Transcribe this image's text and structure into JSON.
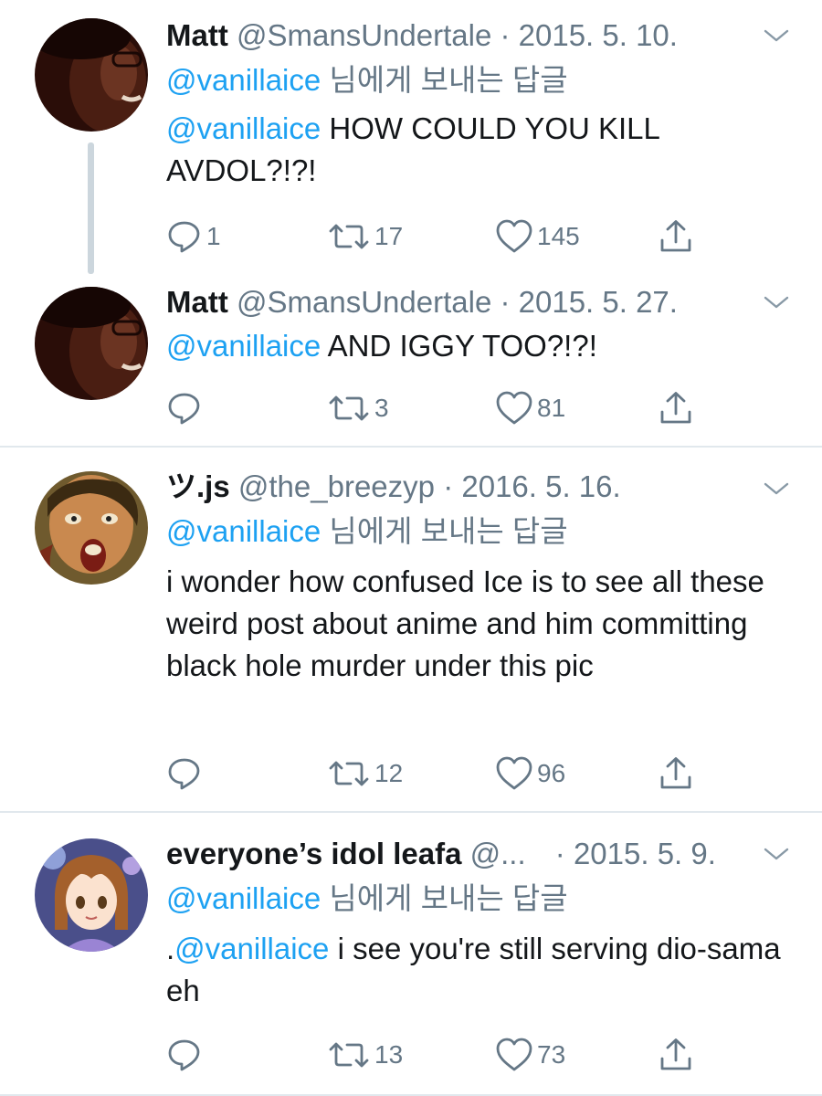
{
  "tweets": [
    {
      "name": "Matt",
      "handle": "@SmansUndertale",
      "dot": "·",
      "date": "2015. 5. 10.",
      "replying_mention": "@vanillaice",
      "replying_rest": " 님에게 보내는 답글",
      "body_mention": "@vanillaice",
      "body_text": " HOW COULD YOU KILL AVDOL?!?!",
      "replies": "1",
      "retweets": "17",
      "likes": "145",
      "avatar_icon": "dark-portrait-avatar"
    },
    {
      "name": "Matt",
      "handle": "@SmansUndertale",
      "dot": "·",
      "date": "2015. 5. 27.",
      "body_mention": "@vanillaice",
      "body_text": " AND IGGY TOO?!?!",
      "replies": "",
      "retweets": "3",
      "likes": "81",
      "avatar_icon": "dark-portrait-avatar"
    },
    {
      "name": "ツ.js",
      "handle": "@the_breezyp",
      "dot": "·",
      "date": "2016. 5. 16.",
      "replying_mention": "@vanillaice",
      "replying_rest": " 님에게 보내는 답글",
      "body_text": "i wonder how confused Ice is to see all these weird post about anime and him committing black hole murder under this pic",
      "replies": "",
      "retweets": "12",
      "likes": "96",
      "avatar_icon": "painted-face-avatar"
    },
    {
      "name": "everyone’s idol leafa",
      "handle": "@...",
      "dot": "·",
      "date": "2015. 5. 9.",
      "replying_mention": "@vanillaice",
      "replying_rest": " 님에게 보내는 답글",
      "body_prefix": ".",
      "body_mention": "@vanillaice",
      "body_text": " i see you're still serving dio-sama eh",
      "replies": "",
      "retweets": "13",
      "likes": "73",
      "avatar_icon": "anime-girl-avatar"
    }
  ],
  "colors": {
    "link": "#1da1f2",
    "secondary": "#657786",
    "text": "#14171a",
    "separator": "#e1e8ed",
    "thread_line": "#ccd6dd"
  }
}
